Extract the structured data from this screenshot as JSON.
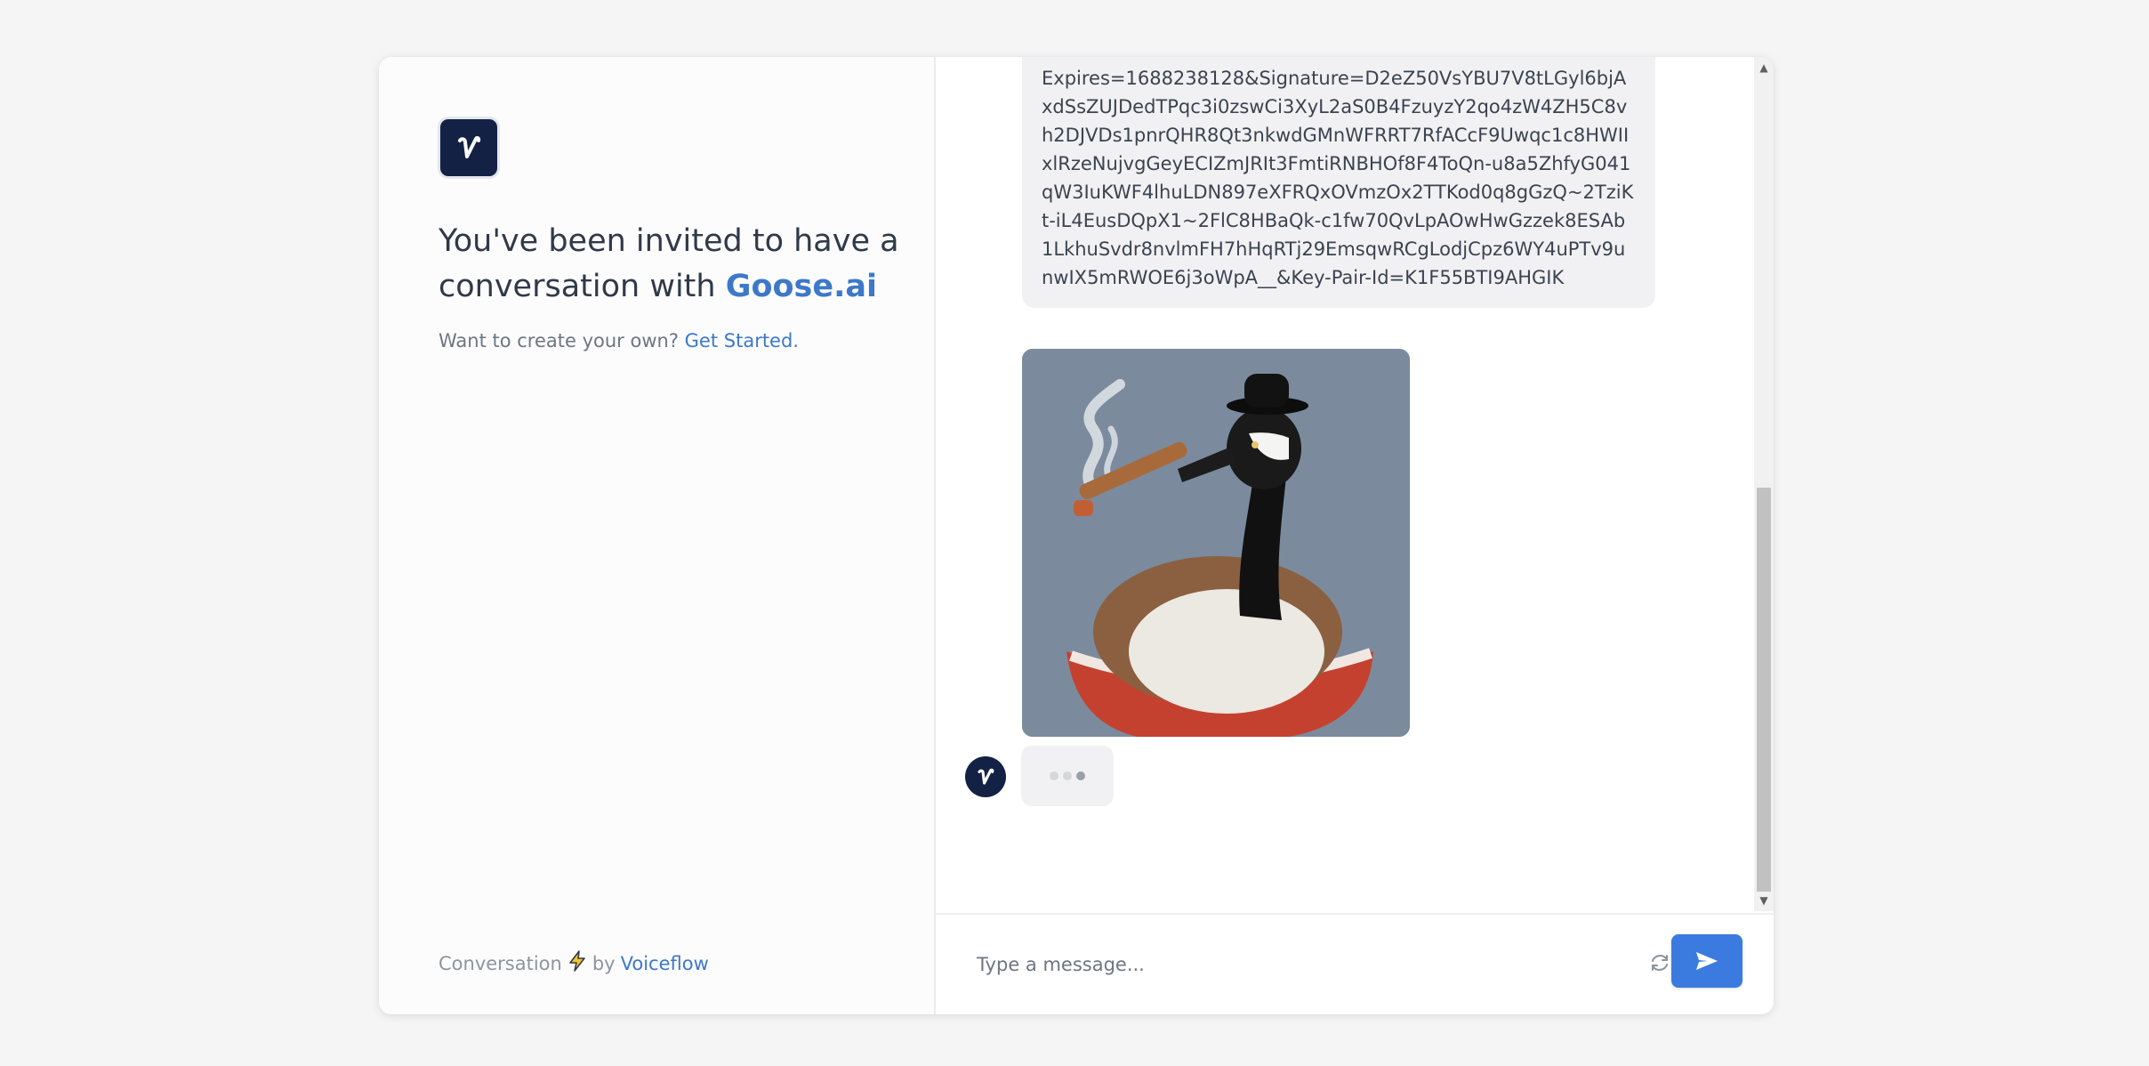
{
  "invite": {
    "headline_prefix": "You've been invited to have a conversation with ",
    "brand_name": "Goose.ai",
    "subline_prefix": "Want to create your own? ",
    "get_started": "Get Started",
    "subline_suffix": "."
  },
  "footer": {
    "prefix": "Conversation",
    "by": "by",
    "brand": "Voiceflow"
  },
  "messages": {
    "url_text": "Expires=1688238128&Signature=D2eZ50VsYBU7V8tLGyl6bjAxdSsZUJDedTPqc3i0zswCi3XyL2aS0B4FzuyzY2qo4zW4ZH5C8vh2DJVDs1pnrQHR8Qt3nkwdGMnWFRRT7RfACcF9Uwqc1c8HWIIxlRzeNujvgGeyECIZmJRIt3FmtiRNBHOf8F4ToQn-u8a5ZhfyG041qW3IuKWF4lhuLDN897eXFRQxOVmzOx2TTKod0q8gGzQ~2TziKt-iL4EusDQpX1~2FlC8HBaQk-c1fw70QvLpAOwHwGzzek8ESAb1LkhuSvdr8nvlmFH7hHqRTj29EmsqwRCgLodjCpz6WY4uPTv9unwIX5mRWOE6j3oWpA__&Key-Pair-Id=K1F55BTI9AHGIK"
  },
  "composer": {
    "placeholder": "Type a message..."
  },
  "colors": {
    "accent": "#3d78c9",
    "send_button": "#3b7be0",
    "logo_bg": "#132144"
  },
  "icons": [
    "voiceflow-logo-icon",
    "lightning-icon",
    "refresh-icon",
    "send-icon"
  ]
}
